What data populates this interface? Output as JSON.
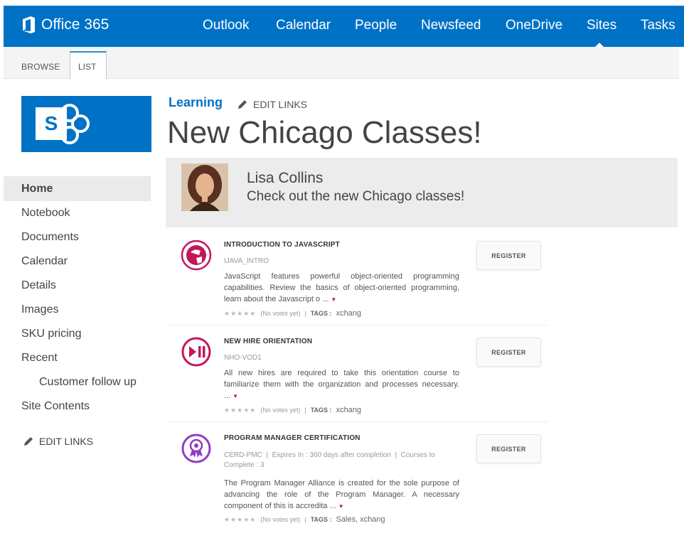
{
  "suite": {
    "brand": "Office 365",
    "nav": [
      "Outlook",
      "Calendar",
      "People",
      "Newsfeed",
      "OneDrive",
      "Sites",
      "Tasks"
    ],
    "active": "Sites"
  },
  "ribbon": {
    "tabs": [
      "BROWSE",
      "LIST"
    ],
    "active": "LIST"
  },
  "site": {
    "logo_letter": "S"
  },
  "leftnav": {
    "items": [
      "Home",
      "Notebook",
      "Documents",
      "Calendar",
      "Details",
      "Images",
      "SKU pricing",
      "Recent",
      "Customer follow up",
      "Site Contents"
    ],
    "edit_links": "EDIT LINKS"
  },
  "header": {
    "breadcrumb": "Learning",
    "edit_links": "EDIT LINKS",
    "title": "New Chicago Classes!"
  },
  "announcement": {
    "author": "Lisa Collins",
    "message": "Check out the new Chicago classes!"
  },
  "courses": [
    {
      "title": "INTRODUCTION TO JAVASCRIPT",
      "code": "IJAVA_INTRO",
      "description": "JavaScript features powerful object-oriented programming capabilities. Review the basics of object-oriented programming, learn about the Javascript o ...",
      "votes": "(No votes yet)",
      "tags_label": "TAGS :",
      "tags": "xchang",
      "register": "REGISTER",
      "icon": "globe-touch-icon",
      "color": "#c2185b"
    },
    {
      "title": "NEW HIRE ORIENTATION",
      "code": "NHO-VOD1",
      "description": "All new hires are required to take this orientation course to familiarize them with the organization and processes necessary. ...",
      "votes": "(No votes yet)",
      "tags_label": "TAGS :",
      "tags": "xchang",
      "register": "REGISTER",
      "icon": "play-pause-icon",
      "color": "#c2185b"
    },
    {
      "title": "PROGRAM MANAGER CERTIFICATION",
      "code": "CERD-PMC",
      "expires": "Expires In : 360 days after completion",
      "courses_to_complete": "Courses to Complete : 3",
      "description": "The Program Manager Alliance is created for the sole purpose of advancing the role of the Program Manager. A necessary component of this is accredita ...",
      "votes": "(No votes yet)",
      "tags_label": "TAGS :",
      "tags": "Sales, xchang",
      "register": "REGISTER",
      "icon": "certificate-badge-icon",
      "color": "#8e3cc6"
    }
  ]
}
